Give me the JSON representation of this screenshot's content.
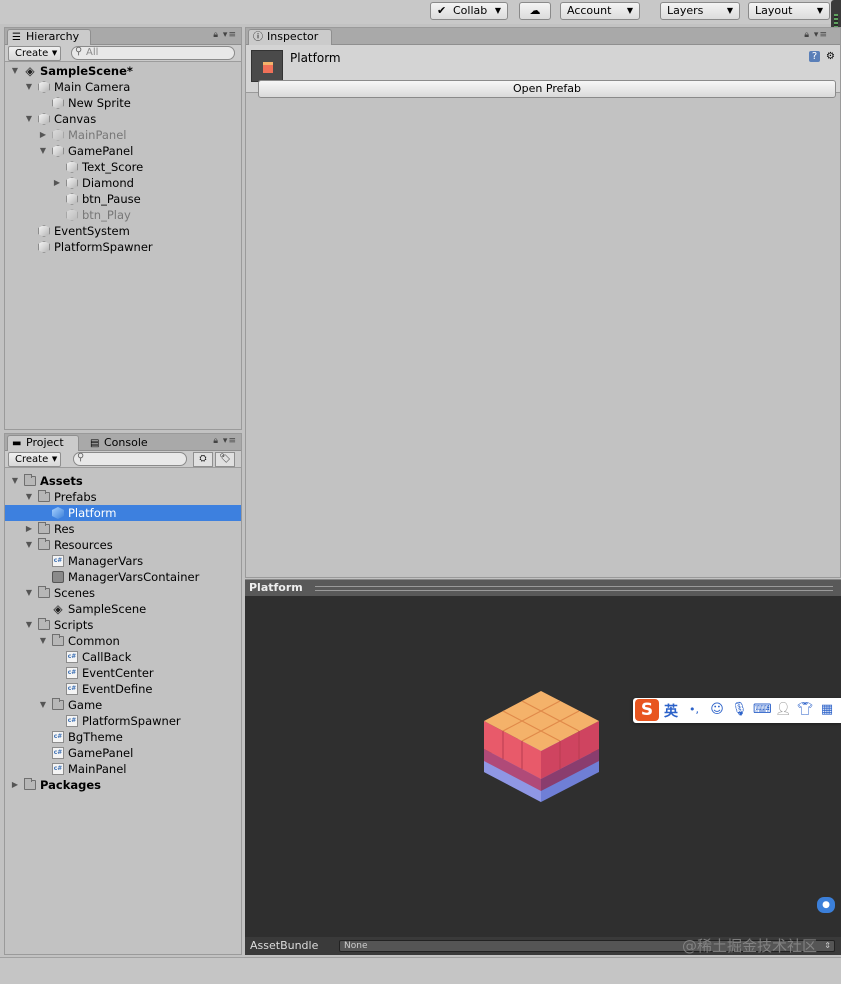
{
  "toolbar": {
    "collab": "Collab",
    "account": "Account",
    "layers": "Layers",
    "layout": "Layout"
  },
  "hierarchy": {
    "tab": "Hierarchy",
    "create": "Create",
    "search_placeholder": "All",
    "items": [
      {
        "label": "SampleScene*",
        "depth": 0,
        "expanded": true,
        "icon": "unity-scene-icon",
        "bold": true
      },
      {
        "label": "Main Camera",
        "depth": 1,
        "expanded": true,
        "icon": "gameobject-icon"
      },
      {
        "label": "New Sprite",
        "depth": 2,
        "icon": "gameobject-icon"
      },
      {
        "label": "Canvas",
        "depth": 1,
        "expanded": true,
        "icon": "gameobject-icon"
      },
      {
        "label": "MainPanel",
        "depth": 2,
        "expanded": false,
        "icon": "gameobject-icon",
        "dim": true
      },
      {
        "label": "GamePanel",
        "depth": 2,
        "expanded": true,
        "icon": "gameobject-icon"
      },
      {
        "label": "Text_Score",
        "depth": 3,
        "icon": "gameobject-icon"
      },
      {
        "label": "Diamond",
        "depth": 3,
        "expanded": false,
        "icon": "gameobject-icon"
      },
      {
        "label": "btn_Pause",
        "depth": 3,
        "icon": "gameobject-icon"
      },
      {
        "label": "btn_Play",
        "depth": 3,
        "icon": "gameobject-icon",
        "dim": true
      },
      {
        "label": "EventSystem",
        "depth": 1,
        "icon": "gameobject-icon"
      },
      {
        "label": "PlatformSpawner",
        "depth": 1,
        "icon": "gameobject-icon"
      }
    ]
  },
  "project": {
    "tab_project": "Project",
    "tab_console": "Console",
    "create": "Create",
    "items": [
      {
        "label": "Assets",
        "depth": 0,
        "expanded": true,
        "icon": "folder-icon",
        "bold": true
      },
      {
        "label": "Prefabs",
        "depth": 1,
        "expanded": true,
        "icon": "folder-icon"
      },
      {
        "label": "Platform",
        "depth": 2,
        "icon": "prefab-icon",
        "selected": true
      },
      {
        "label": "Res",
        "depth": 1,
        "expanded": false,
        "icon": "folder-icon"
      },
      {
        "label": "Resources",
        "depth": 1,
        "expanded": true,
        "icon": "folder-icon"
      },
      {
        "label": "ManagerVars",
        "depth": 2,
        "icon": "cs-script-icon"
      },
      {
        "label": "ManagerVarsContainer",
        "depth": 2,
        "icon": "scriptable-object-icon"
      },
      {
        "label": "Scenes",
        "depth": 1,
        "expanded": true,
        "icon": "folder-icon"
      },
      {
        "label": "SampleScene",
        "depth": 2,
        "icon": "unity-scene-icon"
      },
      {
        "label": "Scripts",
        "depth": 1,
        "expanded": true,
        "icon": "folder-icon"
      },
      {
        "label": "Common",
        "depth": 2,
        "expanded": true,
        "icon": "folder-icon"
      },
      {
        "label": "CallBack",
        "depth": 3,
        "icon": "cs-script-icon"
      },
      {
        "label": "EventCenter",
        "depth": 3,
        "icon": "cs-script-icon"
      },
      {
        "label": "EventDefine",
        "depth": 3,
        "icon": "cs-script-icon"
      },
      {
        "label": "Game",
        "depth": 2,
        "expanded": true,
        "icon": "folder-icon"
      },
      {
        "label": "PlatformSpawner",
        "depth": 3,
        "icon": "cs-script-icon"
      },
      {
        "label": "BgTheme",
        "depth": 2,
        "icon": "cs-script-icon"
      },
      {
        "label": "GamePanel",
        "depth": 2,
        "icon": "cs-script-icon"
      },
      {
        "label": "MainPanel",
        "depth": 2,
        "icon": "cs-script-icon"
      },
      {
        "label": "Packages",
        "depth": 0,
        "expanded": false,
        "icon": "folder-icon",
        "bold": true
      }
    ]
  },
  "inspector": {
    "tab": "Inspector",
    "title": "Platform",
    "open_prefab": "Open Prefab"
  },
  "preview": {
    "title": "Platform",
    "assetbundle_label": "AssetBundle",
    "assetbundle_value": "None",
    "watermark": "@稀土掘金技术社区"
  },
  "ime": {
    "lang": "英",
    "punct": "•,"
  },
  "colors": {
    "selection": "#3d80df",
    "platform_top": "#f4b26a",
    "platform_side": "#f07058",
    "platform_base": "#7f8ad8",
    "ime_brand": "#e8551f"
  }
}
